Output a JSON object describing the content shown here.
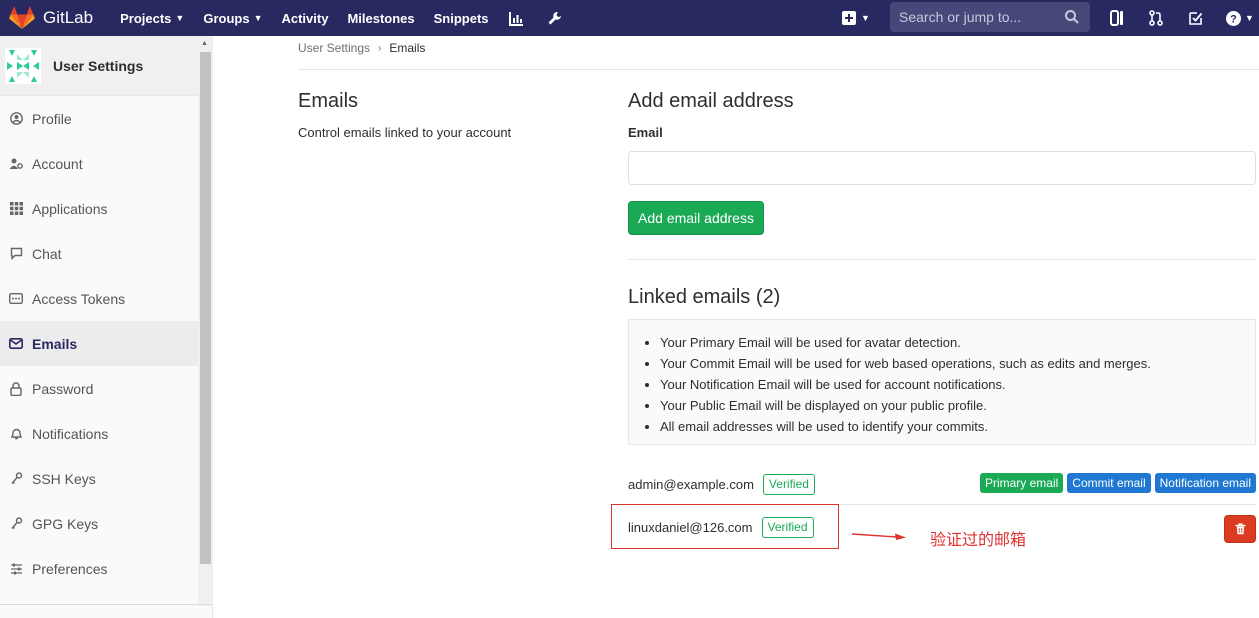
{
  "navbar": {
    "brand": "GitLab",
    "links": [
      {
        "label": "Projects",
        "has_caret": true
      },
      {
        "label": "Groups",
        "has_caret": true
      },
      {
        "label": "Activity",
        "has_caret": false
      },
      {
        "label": "Milestones",
        "has_caret": false
      },
      {
        "label": "Snippets",
        "has_caret": false
      }
    ],
    "search_placeholder": "Search or jump to...",
    "bg_color": "#292961"
  },
  "sidebar": {
    "title": "User Settings",
    "items": [
      {
        "label": "Profile",
        "icon": "user-circle-icon"
      },
      {
        "label": "Account",
        "icon": "user-gear-icon"
      },
      {
        "label": "Applications",
        "icon": "grid-icon"
      },
      {
        "label": "Chat",
        "icon": "chat-icon"
      },
      {
        "label": "Access Tokens",
        "icon": "token-icon"
      },
      {
        "label": "Emails",
        "icon": "envelope-icon",
        "active": true
      },
      {
        "label": "Password",
        "icon": "lock-icon"
      },
      {
        "label": "Notifications",
        "icon": "bell-icon"
      },
      {
        "label": "SSH Keys",
        "icon": "key-icon"
      },
      {
        "label": "GPG Keys",
        "icon": "key-icon"
      },
      {
        "label": "Preferences",
        "icon": "sliders-icon"
      }
    ]
  },
  "breadcrumb": {
    "parent": "User Settings",
    "current": "Emails"
  },
  "intro": {
    "title": "Emails",
    "description": "Control emails linked to your account"
  },
  "add_form": {
    "title": "Add email address",
    "email_label": "Email",
    "email_value": "",
    "button_label": "Add email address"
  },
  "linked": {
    "title": "Linked emails (2)",
    "info": [
      "Your Primary Email will be used for avatar detection.",
      "Your Commit Email will be used for web based operations, such as edits and merges.",
      "Your Notification Email will be used for account notifications.",
      "Your Public Email will be displayed on your public profile.",
      "All email addresses will be used to identify your commits."
    ],
    "emails": [
      {
        "address": "admin@example.com",
        "status": "Verified",
        "badges": [
          "Primary email",
          "Commit email",
          "Notification email"
        ]
      },
      {
        "address": "linuxdaniel@126.com",
        "status": "Verified",
        "badges": []
      }
    ]
  },
  "annotation": {
    "text": "验证过的邮箱",
    "color": "#e03131"
  },
  "colors": {
    "accent_green": "#1aaa55",
    "accent_blue": "#1f78d1",
    "danger": "#db3b21"
  }
}
